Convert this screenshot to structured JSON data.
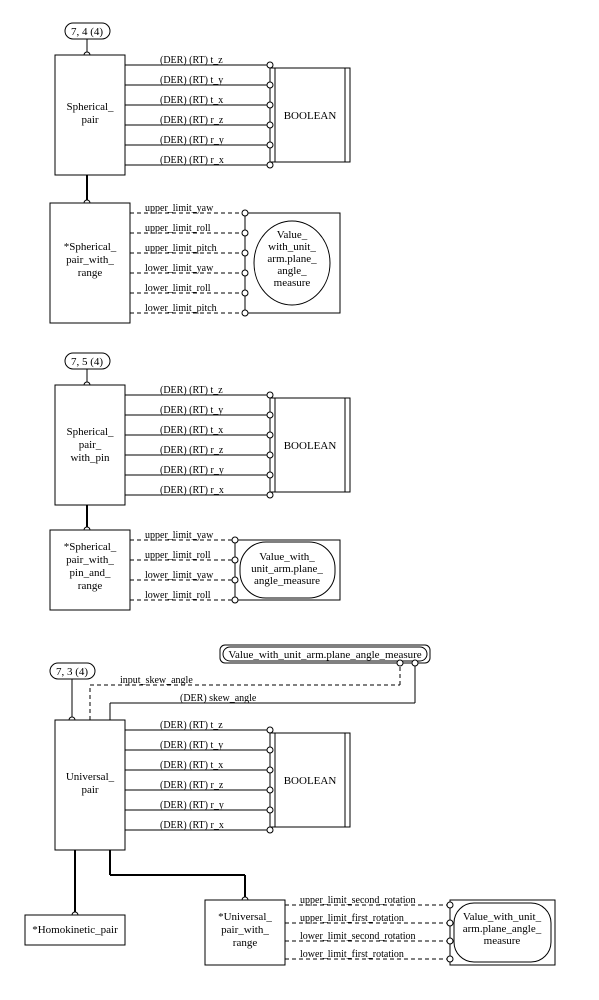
{
  "pageref1": "7, 4 (4)",
  "pageref2": "7, 5 (4)",
  "pageref3": "7, 3 (4)",
  "bool": "BOOLEAN",
  "e_sph": "Spherical_\npair",
  "e_sph_range": "*Spherical_\npair_with_\nrange",
  "e_sph_pin": "Spherical_\npair_\nwith_pin",
  "e_sph_pin_range": "*Spherical_\npair_with_\npin_and_\nrange",
  "e_uni": "Universal_\npair",
  "e_homo": "*Homokinetic_pair",
  "e_uni_range": "*Universal_\npair_with_\nrange",
  "val_plane_multi": "Value_\nwith_unit_\narm.plane_\nangle_\nmeasure",
  "val_plane_3line": "Value_with_\nunit_arm.plane_\nangle_measure",
  "val_plane_4line": "Value_with_unit_\narm.plane_angle_\nmeasure",
  "val_plane_1line": "Value_with_unit_arm.plane_angle_measure",
  "attrs_der": [
    "(DER) (RT) t_z",
    "(DER) (RT) t_y",
    "(DER) (RT) t_x",
    "(DER) (RT) r_z",
    "(DER) (RT) r_y",
    "(DER) (RT) r_x"
  ],
  "sph_range_attrs": [
    "upper_limit_yaw",
    "upper_limit_roll",
    "upper_limit_pitch",
    "lower_limit_yaw",
    "lower_limit_roll",
    "lower_limit_pitch"
  ],
  "sph_pin_range_attrs": [
    "upper_limit_yaw",
    "upper_limit_roll",
    "lower_limit_yaw",
    "lower_limit_roll"
  ],
  "uni_range_attrs": [
    "upper_limit_second_rotation",
    "upper_limit_first_rotation",
    "lower_limit_second_rotation",
    "lower_limit_first_rotation"
  ],
  "skew_in": "input_skew_angle",
  "skew_der": "(DER) skew_angle"
}
